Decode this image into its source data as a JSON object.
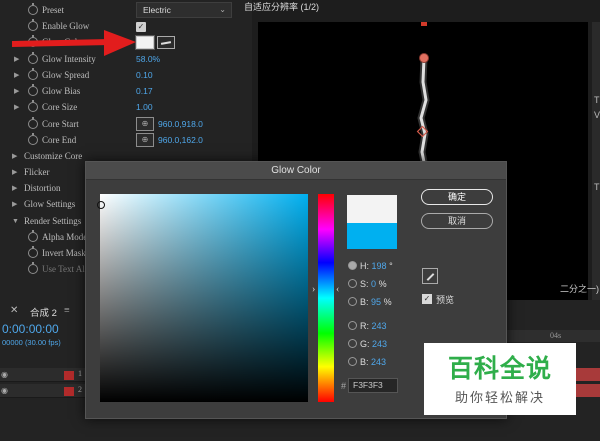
{
  "effect_controls": {
    "rows": [
      {
        "label": "Preset",
        "value": "Electric"
      },
      {
        "label": "Enable Glow",
        "value": ""
      },
      {
        "label": "Glow Color",
        "value": ""
      },
      {
        "label": "Glow Intensity",
        "value": "58.0%"
      },
      {
        "label": "Glow Spread",
        "value": "0.10"
      },
      {
        "label": "Glow Bias",
        "value": "0.17"
      },
      {
        "label": "Core Size",
        "value": "1.00"
      },
      {
        "label": "Core Start",
        "value": "960.0,918.0"
      },
      {
        "label": "Core End",
        "value": "960.0,162.0"
      },
      {
        "label": "Customize Core",
        "value": ""
      },
      {
        "label": "Flicker",
        "value": ""
      },
      {
        "label": "Distortion",
        "value": ""
      },
      {
        "label": "Glow Settings",
        "value": ""
      },
      {
        "label": "Render Settings",
        "value": ""
      },
      {
        "label": "Alpha Mode",
        "value": ""
      },
      {
        "label": "Invert Mask",
        "value": ""
      },
      {
        "label": "Use Text Al",
        "value": ""
      }
    ],
    "enable_glow_checked": true,
    "glow_color": "#F3F3F3"
  },
  "viewer": {
    "title": "自适应分辨率 (1/2)",
    "zoom_label": "二分之一)",
    "right_strip_letters": [
      "T",
      "V",
      "T"
    ]
  },
  "timeline": {
    "tab": "合成 2",
    "timecode": "0:00:00:00",
    "fps": "00000 (30.00 fps)",
    "ruler_label": "04s",
    "layers": [
      "1",
      "2"
    ]
  },
  "dialog": {
    "title": "Glow Color",
    "ok": "确定",
    "cancel": "取消",
    "preview": "预览",
    "channels": [
      {
        "key": "H:",
        "value": "198",
        "unit": "°",
        "selected": true
      },
      {
        "key": "S:",
        "value": "0",
        "unit": "%",
        "selected": false
      },
      {
        "key": "B:",
        "value": "95",
        "unit": "%",
        "selected": false
      },
      {
        "key": "R:",
        "value": "243",
        "unit": "",
        "selected": false
      },
      {
        "key": "G:",
        "value": "243",
        "unit": "",
        "selected": false
      },
      {
        "key": "B:",
        "value": "243",
        "unit": "",
        "selected": false
      }
    ],
    "hex": "F3F3F3",
    "hex_prefix": "#",
    "new_color": "#F3F3F3",
    "old_color": "#00B0F0"
  },
  "watermark": {
    "title": "百科全说",
    "subtitle": "助你轻松解决"
  }
}
